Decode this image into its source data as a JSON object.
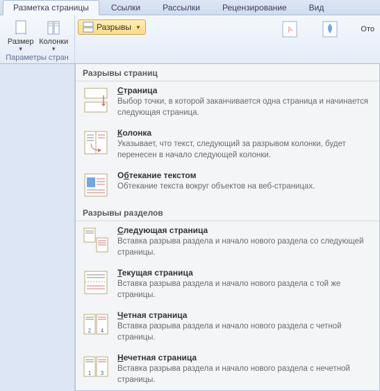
{
  "tabs": {
    "active": "Разметка страницы",
    "t1": "Ссылки",
    "t2": "Рассылки",
    "t3": "Рецензирование",
    "t4": "Вид"
  },
  "ribbon": {
    "size_label": "Размер",
    "columns_label": "Колонки",
    "group_label": "Параметры стран",
    "breaks_label": "Разрывы",
    "right_label": "Ото"
  },
  "dropdown": {
    "section1": "Разрывы страниц",
    "section2": "Разрывы разделов",
    "items": [
      {
        "title": "Страница",
        "mn": "С",
        "rest": "траница",
        "desc": "Выбор точки, в которой заканчивается одна страница и начинается следующая страница."
      },
      {
        "title": "Колонка",
        "mn": "К",
        "rest": "олонка",
        "desc": "Указывает, что текст, следующий за разрывом колонки, будет перенесен в начало следующей колонки."
      },
      {
        "title": "Обтекание текстом",
        "mn": "б",
        "pre": "О",
        "rest": "текание текстом",
        "desc": "Обтекание текста вокруг объектов на веб-страницах."
      },
      {
        "title": "Следующая страница",
        "mn": "С",
        "rest": "ледующая страница",
        "desc": "Вставка разрыва раздела и начало нового раздела со следующей страницы."
      },
      {
        "title": "Текущая страница",
        "mn": "Т",
        "rest": "екущая страница",
        "desc": "Вставка разрыва раздела и начало нового раздела с той же страницы."
      },
      {
        "title": "Четная страница",
        "mn": "Ч",
        "rest": "етная страница",
        "desc": "Вставка разрыва раздела и начало нового раздела с четной страницы."
      },
      {
        "title": "Нечетная страница",
        "mn": "Н",
        "rest": "ечетная страница",
        "desc": "Вставка разрыва раздела и начало нового раздела с нечетной страницы."
      }
    ]
  }
}
